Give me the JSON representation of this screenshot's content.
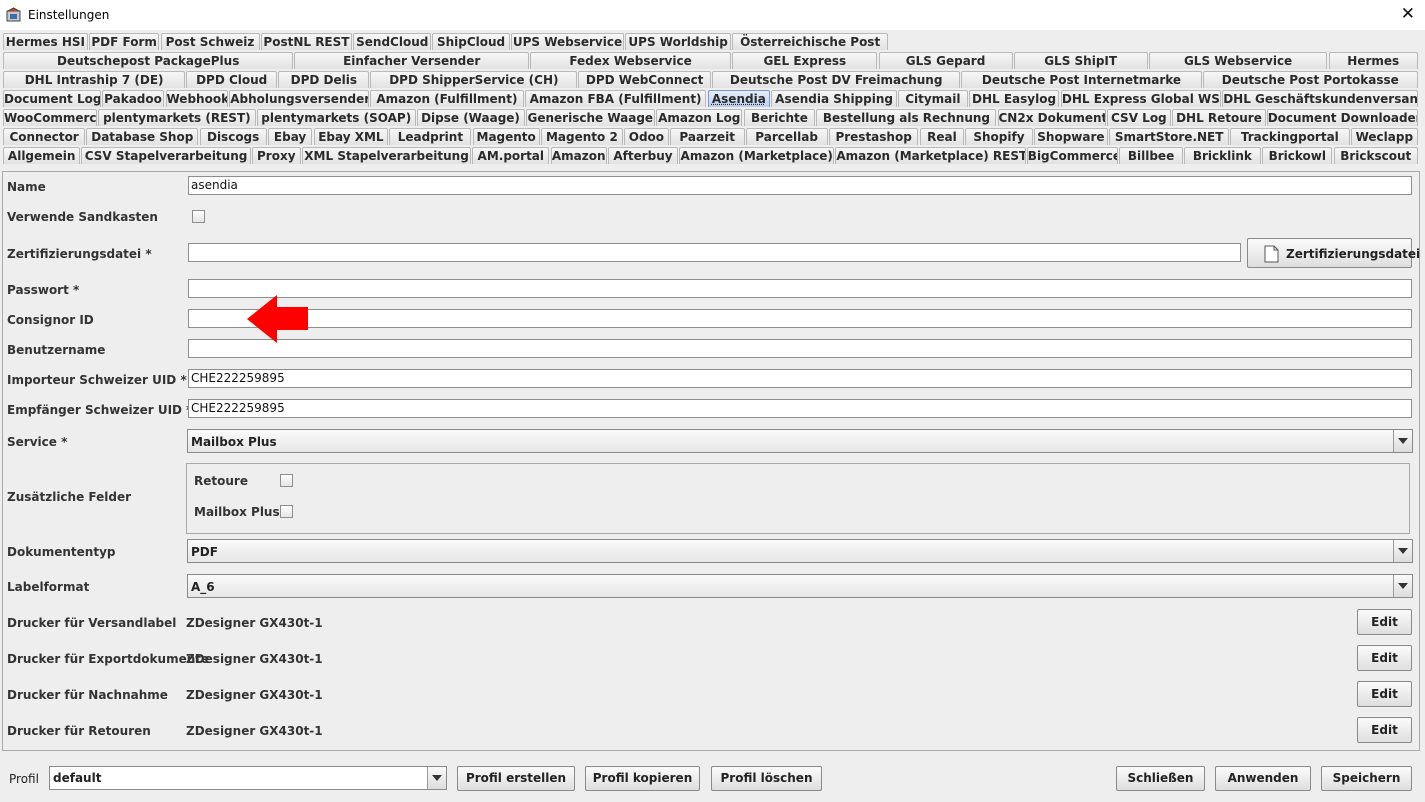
{
  "window": {
    "title": "Einstellungen",
    "close_glyph": "✕"
  },
  "tab_rows": [
    [
      "Hermes HSI",
      "PDF Form",
      "Post Schweiz",
      "PostNL REST",
      "SendCloud",
      "ShipCloud",
      "UPS Webservice",
      "UPS Worldship",
      "Österreichische Post"
    ],
    [
      "Deutschepost PackagePlus",
      "Einfacher Versender",
      "Fedex Webservice",
      "GEL Express",
      "GLS Gepard",
      "GLS ShipIT",
      "GLS Webservice",
      "Hermes"
    ],
    [
      "DHL Intraship 7 (DE)",
      "DPD Cloud",
      "DPD Delis",
      "DPD ShipperService (CH)",
      "DPD WebConnect",
      "Deutsche Post DV Freimachung",
      "Deutsche Post Internetmarke",
      "Deutsche Post Portokasse"
    ],
    [
      "Document Log",
      "Pakadoo",
      "Webhook",
      "Abholungsversender",
      "Amazon (Fulfillment)",
      "Amazon FBA (Fulfillment)",
      "Asendia",
      "Asendia Shipping",
      "Citymail",
      "DHL Easylog",
      "DHL Express Global WS",
      "DHL Geschäftskundenversand"
    ],
    [
      "WooCommerce",
      "plentymarkets (REST)",
      "plentymarkets (SOAP)",
      "Dipse (Waage)",
      "Generische Waage",
      "Amazon Log",
      "Berichte",
      "Bestellung als Rechnung",
      "CN2x Dokument",
      "CSV Log",
      "DHL Retoure",
      "Document Downloader"
    ],
    [
      "Connector",
      "Database Shop",
      "Discogs",
      "Ebay",
      "Ebay XML",
      "Leadprint",
      "Magento",
      "Magento 2",
      "Odoo",
      "Paarzeit",
      "Parcellab",
      "Prestashop",
      "Real",
      "Shopify",
      "Shopware",
      "SmartStore.NET",
      "Trackingportal",
      "Weclapp"
    ],
    [
      "Allgemein",
      "CSV Stapelverarbeitung",
      "Proxy",
      "XML Stapelverarbeitung",
      "AM.portal",
      "Amazon",
      "Afterbuy",
      "Amazon (Marketplace)",
      "Amazon (Marketplace) REST",
      "BigCommerce",
      "Billbee",
      "Bricklink",
      "Brickowl",
      "Brickscout"
    ]
  ],
  "active_tab": "Asendia",
  "form": {
    "name_label": "Name",
    "name_value": "asendia",
    "sandbox_label": "Verwende Sandkasten",
    "cert_label": "Zertifizierungsdatei *",
    "cert_value": "",
    "cert_button": "Zertifizierungsdatei",
    "password_label": "Passwort *",
    "password_value": "",
    "consignor_label": "Consignor ID",
    "consignor_value": "",
    "username_label": "Benutzername",
    "username_value": "",
    "importer_uid_label": "Importeur Schweizer UID *",
    "importer_uid_value": "CHE222259895",
    "receiver_uid_label": "Empfänger Schweizer UID *",
    "receiver_uid_value": "CHE222259895",
    "service_label": "Service *",
    "service_value": "Mailbox Plus",
    "extra_fields_label": "Zusätzliche Felder",
    "extra_retoure_label": "Retoure",
    "extra_mailbox_label": "Mailbox Plus",
    "doctype_label": "Dokumententyp",
    "doctype_value": "PDF",
    "labelformat_label": "Labelformat",
    "labelformat_value": "A_6",
    "printers": [
      {
        "label": "Drucker für Versandlabel",
        "value": "ZDesigner GX430t-1",
        "button": "Edit"
      },
      {
        "label": "Drucker für Exportdokumente",
        "value": "ZDesigner GX430t-1",
        "button": "Edit"
      },
      {
        "label": "Drucker für Nachnahme",
        "value": "ZDesigner GX430t-1",
        "button": "Edit"
      },
      {
        "label": "Drucker für Retouren",
        "value": "ZDesigner GX430t-1",
        "button": "Edit"
      }
    ]
  },
  "footer": {
    "profile_label": "Profil",
    "profile_value": "default",
    "create_button": "Profil erstellen",
    "copy_button": "Profil kopieren",
    "delete_button": "Profil löschen",
    "close_button": "Schließen",
    "apply_button": "Anwenden",
    "save_button": "Speichern"
  },
  "annotation": {
    "arrow_color": "#ff0000"
  }
}
